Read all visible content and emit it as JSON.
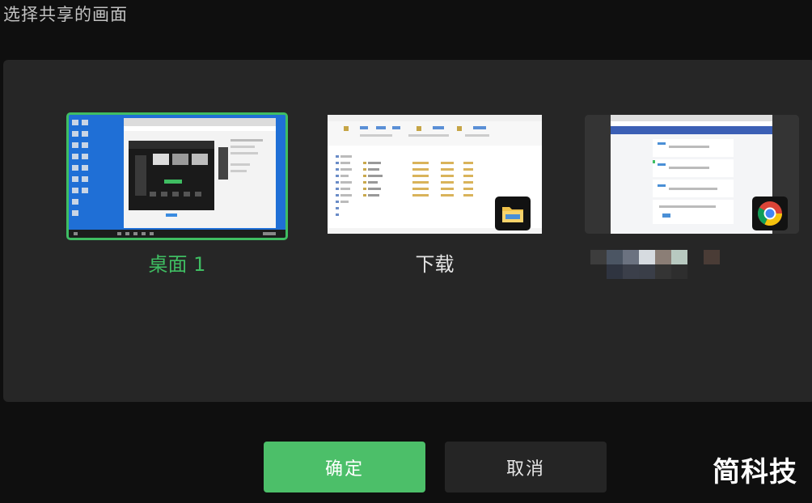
{
  "dialog": {
    "title": "选择共享的画面"
  },
  "sources": [
    {
      "label": "桌面 1",
      "selected": true
    },
    {
      "label": "下载",
      "selected": false,
      "app_icon": "folder-icon"
    },
    {
      "label": "",
      "selected": false,
      "app_icon": "chrome-icon",
      "label_obscured": true
    }
  ],
  "buttons": {
    "confirm": "确定",
    "cancel": "取消"
  },
  "watermark": "简科技",
  "colors": {
    "accent": "#4cbf69",
    "selected_border": "#3fbd62",
    "panel_bg": "#262626",
    "page_bg": "#0f0f0f"
  }
}
